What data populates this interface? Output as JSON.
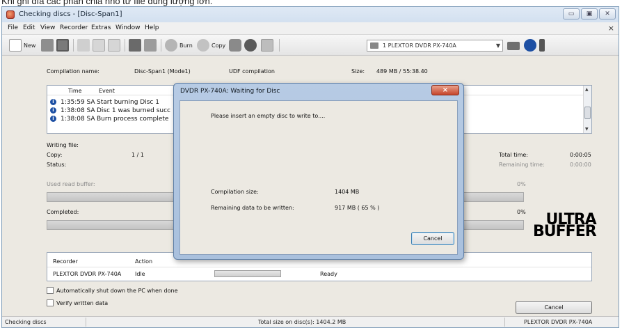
{
  "overlay_caption": "Khi ghi đĩa các phần chia nhỏ từ file dung lượng lớn.",
  "window": {
    "title": "Checking discs - [Disc-Span1]",
    "controls": [
      "min",
      "max",
      "close"
    ]
  },
  "menu": {
    "items": [
      "File",
      "Edit",
      "View",
      "Recorder",
      "Extras",
      "Window",
      "Help"
    ],
    "mdi_close": "×"
  },
  "toolbar": {
    "new_label": "New",
    "burn_label": "Burn",
    "copy_label": "Copy",
    "drive_select": "1 PLEXTOR DVDR  PX-740A",
    "icons": [
      "new-icon",
      "open-icon",
      "save-icon",
      "cut-icon",
      "copy-icon",
      "paste-icon",
      "filter-icon",
      "star-icon",
      "burn-icon",
      "copy-disc-icon",
      "drive-icon",
      "disc-icon",
      "doc-icon",
      "drive-select-icon",
      "monitor-icon",
      "info-icon",
      "more-icon"
    ]
  },
  "compilation": {
    "name_label": "Compilation name:",
    "name_value": "Disc-Span1 (Mode1)",
    "type_value": "UDF compilation",
    "size_label": "Size:",
    "size_value": "489 MB  /  55:38.40"
  },
  "events": {
    "headers": [
      "Time",
      "Event"
    ],
    "rows": [
      {
        "time": "1:35:59 SA",
        "event": "Start burning Disc 1"
      },
      {
        "time": "1:38:08 SA",
        "event": "Disc 1 was burned succ"
      },
      {
        "time": "1:38:08 SA",
        "event": "Burn process complete"
      }
    ]
  },
  "status": {
    "writing_file_label": "Writing file:",
    "copy_label": "Copy:",
    "copy_value": "1 / 1",
    "status_label": "Status:",
    "total_time_label": "Total time:",
    "total_time_value": "0:00:05",
    "remaining_time_label": "Remaining time:",
    "remaining_time_value": "0:00:00",
    "used_buffer_label": "Used read buffer:",
    "used_buffer_value": "0%",
    "completed_label": "Completed:",
    "completed_value": "0%",
    "logo_line1": "ULTRA",
    "logo_line2": "BUFFER"
  },
  "recorders": {
    "headers": [
      "Recorder",
      "Action"
    ],
    "row": {
      "recorder": "PLEXTOR DVDR  PX-740A",
      "action": "Idle",
      "state": "Ready"
    }
  },
  "options": {
    "shutdown": "Automatically shut down the PC when done",
    "verify": "Verify written data"
  },
  "cancel_main": "Cancel",
  "statusbar": {
    "left": "Checking discs",
    "center": "Total size on disc(s): 1404.2 MB",
    "right": "PLEXTOR  DVDR  PX-740A"
  },
  "dialog": {
    "title": "DVDR  PX-740A: Waiting for Disc",
    "message": "Please insert an empty disc to write to....",
    "compilation_size_label": "Compilation size:",
    "compilation_size_value": "1404 MB",
    "remaining_label": "Remaining data to be written:",
    "remaining_value": "917 MB  ( 65 % )",
    "cancel": "Cancel",
    "close": "×"
  }
}
